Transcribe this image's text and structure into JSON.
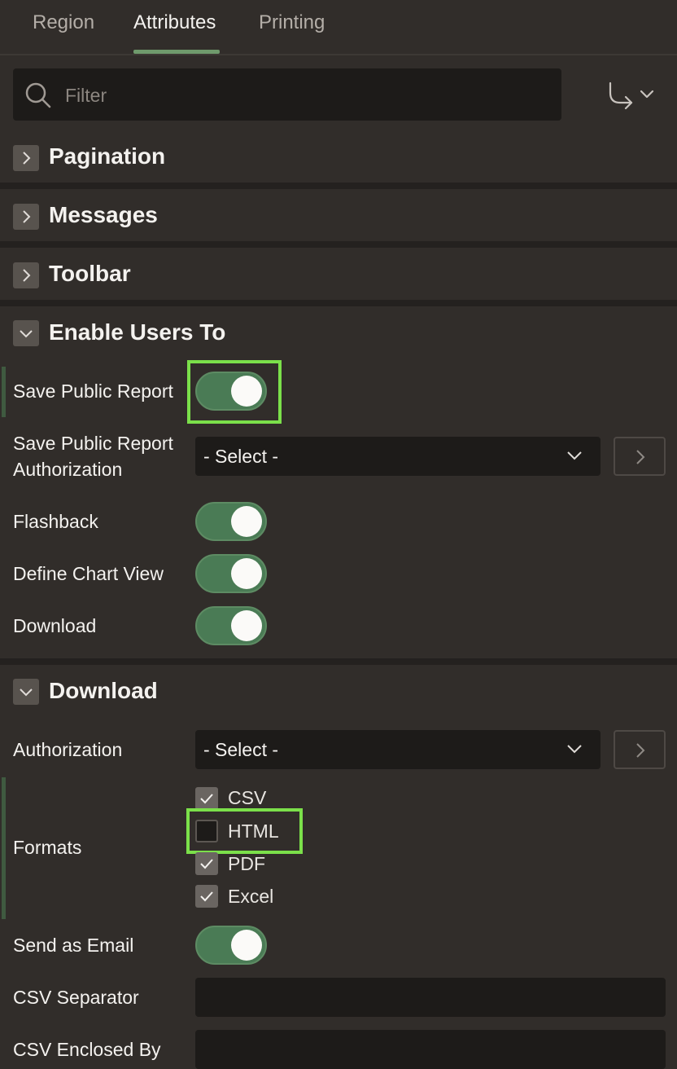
{
  "tabs": [
    {
      "label": "Region",
      "active": false
    },
    {
      "label": "Attributes",
      "active": true
    },
    {
      "label": "Printing",
      "active": false
    }
  ],
  "filter": {
    "placeholder": "Filter"
  },
  "sections": {
    "pagination": {
      "title": "Pagination",
      "expanded": false
    },
    "messages": {
      "title": "Messages",
      "expanded": false
    },
    "toolbar": {
      "title": "Toolbar",
      "expanded": false
    },
    "enable_users_to": {
      "title": "Enable Users To",
      "expanded": true
    },
    "download": {
      "title": "Download",
      "expanded": true
    }
  },
  "enable_users_to": {
    "save_public_report": {
      "label": "Save Public Report",
      "on": true
    },
    "save_public_report_auth": {
      "label_line1": "Save Public Report",
      "label_line2": "Authorization",
      "value": "- Select -"
    },
    "flashback": {
      "label": "Flashback",
      "on": true
    },
    "define_chart_view": {
      "label": "Define Chart View",
      "on": true
    },
    "download": {
      "label": "Download",
      "on": true
    }
  },
  "download": {
    "authorization": {
      "label": "Authorization",
      "value": "- Select -"
    },
    "formats": {
      "label": "Formats",
      "options": [
        {
          "label": "CSV",
          "checked": true
        },
        {
          "label": "HTML",
          "checked": false
        },
        {
          "label": "PDF",
          "checked": true
        },
        {
          "label": "Excel",
          "checked": true
        }
      ]
    },
    "send_as_email": {
      "label": "Send as Email",
      "on": true
    },
    "csv_separator": {
      "label": "CSV Separator",
      "value": ""
    },
    "csv_enclosed_by": {
      "label": "CSV Enclosed By",
      "value": ""
    }
  },
  "colors": {
    "accent": "#4a7b55",
    "highlight": "#7be04a",
    "background": "#312d2a"
  }
}
